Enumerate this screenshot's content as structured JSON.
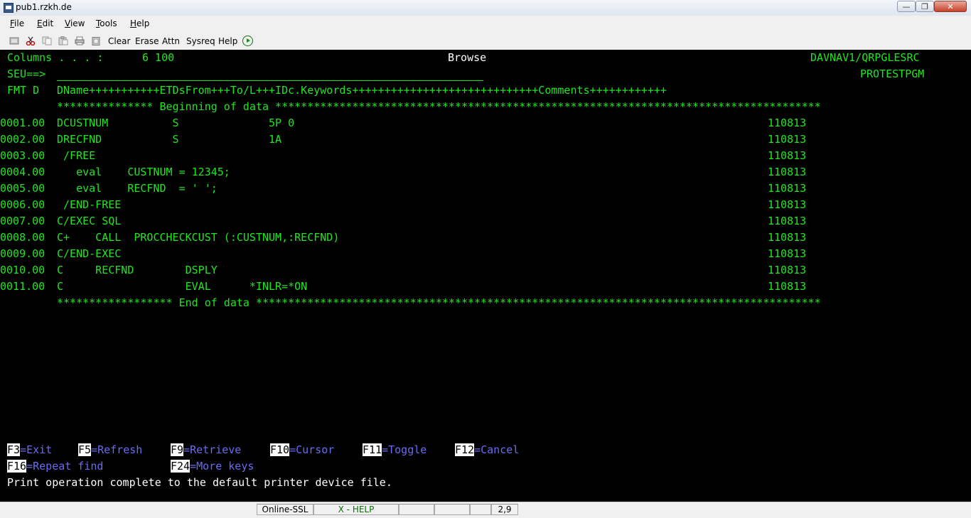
{
  "window": {
    "title": "pub1.rzkh.de"
  },
  "menu": [
    {
      "label": "File",
      "accel": "F",
      "rest": "ile"
    },
    {
      "label": "Edit",
      "accel": "E",
      "rest": "dit"
    },
    {
      "label": "View",
      "accel": "V",
      "rest": "iew"
    },
    {
      "label": "Tools",
      "accel": "T",
      "rest": "ools"
    },
    {
      "label": "Help",
      "accel": "H",
      "rest": "elp"
    }
  ],
  "toolbar": {
    "icons": [
      "record-icon",
      "cut-icon",
      "copy-icon",
      "paste-icon",
      "print-icon",
      "clipboard-icon"
    ],
    "buttons": {
      "clear": "Clear",
      "erase": "Erase",
      "attn": "Attn",
      "sysreq": "Sysreq",
      "help": "Help"
    },
    "run_icon": "play-icon"
  },
  "terminal": {
    "header": {
      "columns_label": "Columns . . . :",
      "columns_value": "6 100",
      "mode": "Browse",
      "library_file": "DAVNAV1/QRPGLESRC",
      "seu_prompt": "SEU==>",
      "member": "PROTESTPGM",
      "format_label": "FMT D",
      "format_ruler": "DName+++++++++++ETDsFrom+++To/L+++IDc.Keywords+++++++++++++++++++++++++++++Comments++++++++++++"
    },
    "beginning_marker": "*************** Beginning of data *************************************************************************************",
    "end_marker": "****************** End of data ****************************************************************************************",
    "source_lines": [
      {
        "seq": "0001.00",
        "code": "DCUSTNUM          S              5P 0",
        "date": "110813"
      },
      {
        "seq": "0002.00",
        "code": "DRECFND           S              1A",
        "date": "110813"
      },
      {
        "seq": "0003.00",
        "code": " /FREE",
        "date": "110813"
      },
      {
        "seq": "0004.00",
        "code": "   eval    CUSTNUM = 12345;",
        "date": "110813"
      },
      {
        "seq": "0005.00",
        "code": "   eval    RECFND  = ' ';",
        "date": "110813"
      },
      {
        "seq": "0006.00",
        "code": " /END-FREE",
        "date": "110813"
      },
      {
        "seq": "0007.00",
        "code": "C/EXEC SQL",
        "date": "110813"
      },
      {
        "seq": "0008.00",
        "code": "C+    CALL  PROCCHECKCUST (:CUSTNUM,:RECFND)",
        "date": "110813"
      },
      {
        "seq": "0009.00",
        "code": "C/END-EXEC",
        "date": "110813"
      },
      {
        "seq": "0010.00",
        "code": "C     RECFND        DSPLY",
        "date": "110813"
      },
      {
        "seq": "0011.00",
        "code": "C                   EVAL      *INLR=*ON",
        "date": "110813"
      }
    ],
    "function_keys": [
      {
        "key": "F3",
        "label": "=Exit"
      },
      {
        "key": "F5",
        "label": "=Refresh"
      },
      {
        "key": "F9",
        "label": "=Retrieve"
      },
      {
        "key": "F10",
        "label": "=Cursor"
      },
      {
        "key": "F11",
        "label": "=Toggle"
      },
      {
        "key": "F12",
        "label": "=Cancel"
      },
      {
        "key": "F16",
        "label": "=Repeat find"
      },
      {
        "key": "F24",
        "label": "=More keys"
      }
    ],
    "message": "Print operation complete to the default printer device file."
  },
  "statusbar": {
    "connection": "Online-SSL",
    "mode": "X - HELP",
    "cursor": "2,9"
  }
}
